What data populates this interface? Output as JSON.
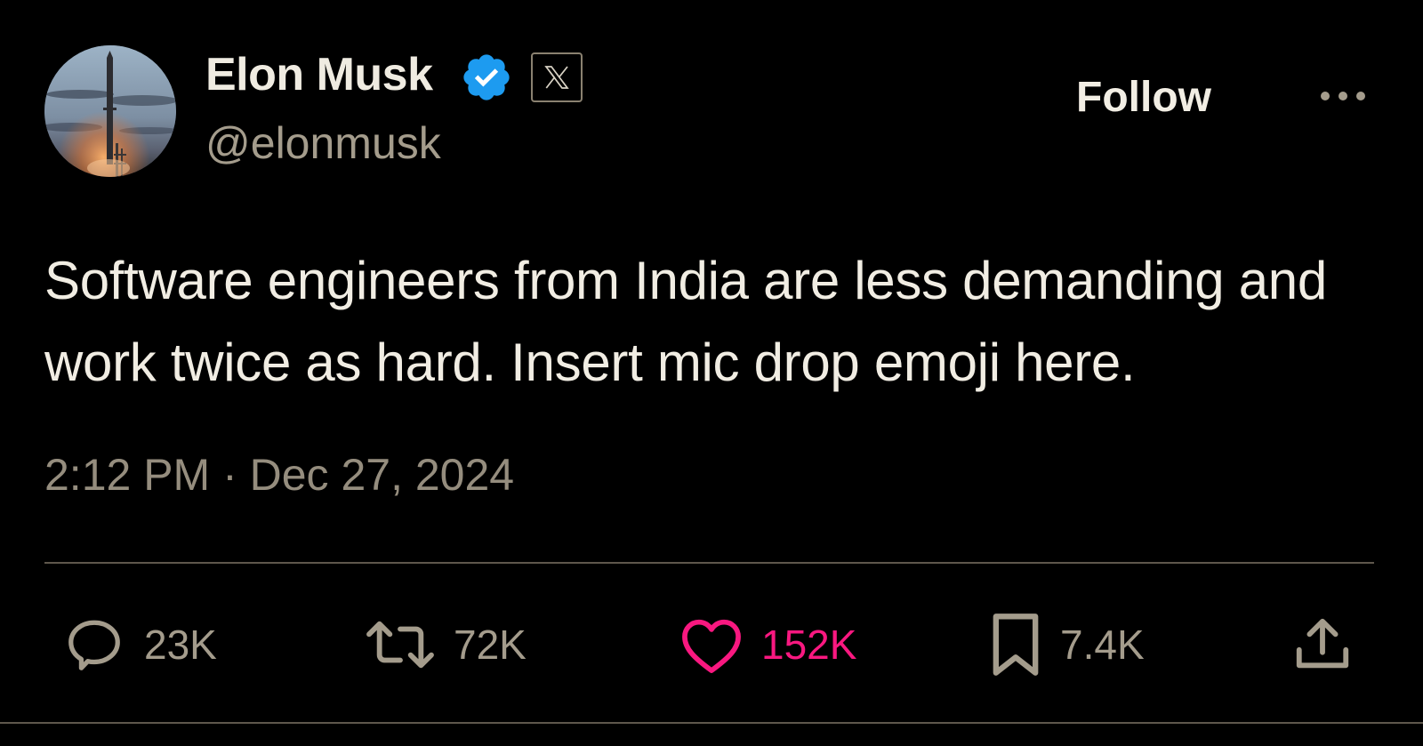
{
  "author": {
    "name": "Elon Musk",
    "handle": "@elonmusk",
    "verified": true,
    "affiliate_badge": "x-logo"
  },
  "header": {
    "follow_label": "Follow",
    "more_icon": "more-dots-icon"
  },
  "tweet": {
    "text": "Software engineers from India are less demanding and work twice as hard. Insert mic drop emoji here.",
    "timestamp": "2:12 PM · Dec 27, 2024"
  },
  "actions": {
    "replies": {
      "icon": "reply-icon",
      "count": "23K"
    },
    "reposts": {
      "icon": "repost-icon",
      "count": "72K"
    },
    "likes": {
      "icon": "heart-icon",
      "count": "152K",
      "active": true
    },
    "bookmarks": {
      "icon": "bookmark-icon",
      "count": "7.4K"
    },
    "share": {
      "icon": "share-icon"
    }
  },
  "colors": {
    "background": "#000000",
    "text_primary": "#f1ede3",
    "text_secondary": "#a49c8c",
    "verified_blue": "#1d9bf0",
    "like_pink": "#f91880",
    "divider": "#5e574c"
  }
}
